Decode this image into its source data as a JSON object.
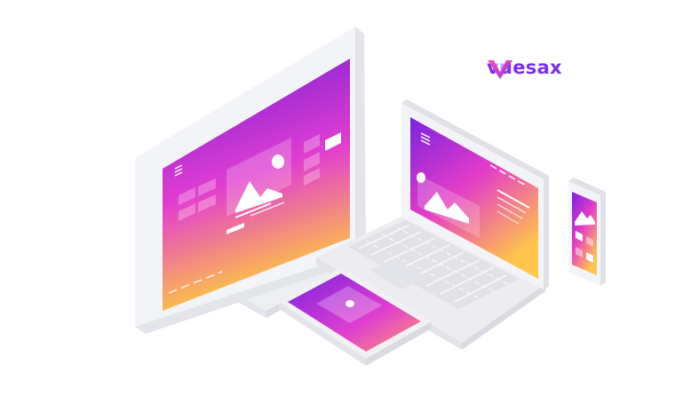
{
  "brand": {
    "name": "vuesax",
    "logo_icon": "vuesax-v-logo-icon",
    "text_color": "#7b2ff2"
  },
  "colors": {
    "gradient_top": "#6a1fd6",
    "gradient_mid": "#e23dd1",
    "gradient_bottom": "#ffcd3c",
    "device_body": "#f1f1f4"
  },
  "devices": [
    "desktop-monitor",
    "laptop",
    "tablet",
    "smartphone"
  ],
  "icons": [
    "image-placeholder-icon",
    "menu-icon"
  ]
}
